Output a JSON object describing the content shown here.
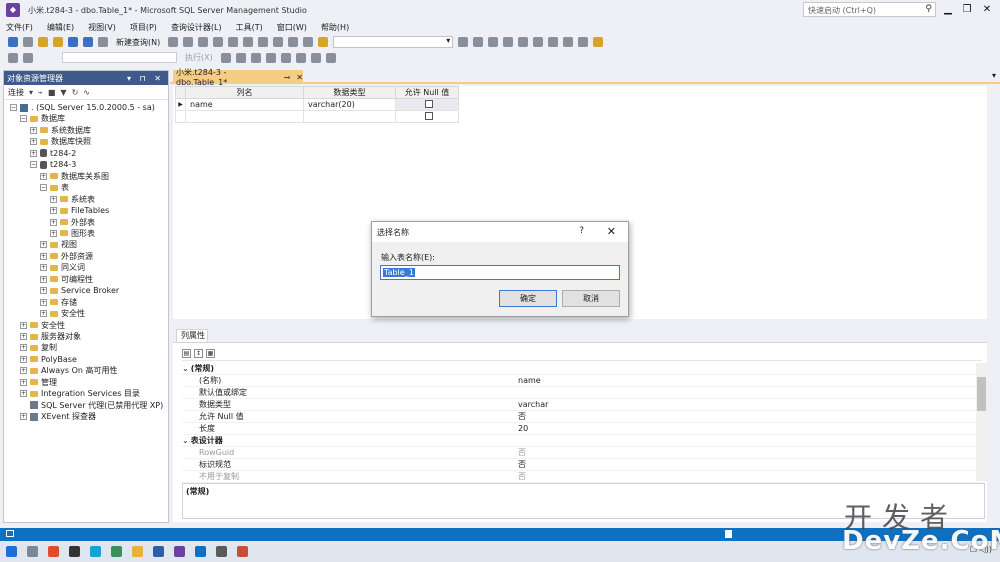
{
  "window": {
    "title": "小米.t284-3 - dbo.Table_1* - Microsoft SQL Server Management Studio",
    "quick_launch_placeholder": "快速启动 (Ctrl+Q)"
  },
  "menu": [
    "文件(F)",
    "编辑(E)",
    "视图(V)",
    "项目(P)",
    "查询设计器(L)",
    "工具(T)",
    "窗口(W)",
    "帮助(H)"
  ],
  "toolbar": {
    "new_query": "新建查询(N)",
    "execute": "执行(X)"
  },
  "object_explorer": {
    "title": "对象资源管理器",
    "connect_label": "连接",
    "nodes": [
      {
        "label": ". (SQL Server 15.0.2000.5 - sa)",
        "level": 0,
        "toggle": "−",
        "icon": "server-icon"
      },
      {
        "label": "数据库",
        "level": 1,
        "toggle": "−",
        "icon": "folder-icon"
      },
      {
        "label": "系统数据库",
        "level": 2,
        "toggle": "+",
        "icon": "folder-icon"
      },
      {
        "label": "数据库快照",
        "level": 2,
        "toggle": "+",
        "icon": "folder-icon"
      },
      {
        "label": "t284-2",
        "level": 2,
        "toggle": "+",
        "icon": "database-icon"
      },
      {
        "label": "t284-3",
        "level": 2,
        "toggle": "−",
        "icon": "database-icon"
      },
      {
        "label": "数据库关系图",
        "level": 3,
        "toggle": "+",
        "icon": "folder-icon"
      },
      {
        "label": "表",
        "level": 3,
        "toggle": "−",
        "icon": "folder-icon"
      },
      {
        "label": "系统表",
        "level": 4,
        "toggle": "+",
        "icon": "folder-icon"
      },
      {
        "label": "FileTables",
        "level": 4,
        "toggle": "+",
        "icon": "folder-icon"
      },
      {
        "label": "外部表",
        "level": 4,
        "toggle": "+",
        "icon": "folder-icon"
      },
      {
        "label": "图形表",
        "level": 4,
        "toggle": "+",
        "icon": "folder-icon"
      },
      {
        "label": "视图",
        "level": 3,
        "toggle": "+",
        "icon": "folder-icon"
      },
      {
        "label": "外部资源",
        "level": 3,
        "toggle": "+",
        "icon": "folder-icon"
      },
      {
        "label": "同义词",
        "level": 3,
        "toggle": "+",
        "icon": "folder-icon"
      },
      {
        "label": "可编程性",
        "level": 3,
        "toggle": "+",
        "icon": "folder-icon"
      },
      {
        "label": "Service Broker",
        "level": 3,
        "toggle": "+",
        "icon": "folder-icon"
      },
      {
        "label": "存储",
        "level": 3,
        "toggle": "+",
        "icon": "folder-icon"
      },
      {
        "label": "安全性",
        "level": 3,
        "toggle": "+",
        "icon": "folder-icon"
      },
      {
        "label": "安全性",
        "level": 1,
        "toggle": "+",
        "icon": "folder-icon"
      },
      {
        "label": "服务器对象",
        "level": 1,
        "toggle": "+",
        "icon": "folder-icon"
      },
      {
        "label": "复制",
        "level": 1,
        "toggle": "+",
        "icon": "folder-icon"
      },
      {
        "label": "PolyBase",
        "level": 1,
        "toggle": "+",
        "icon": "folder-icon"
      },
      {
        "label": "Always On 高可用性",
        "level": 1,
        "toggle": "+",
        "icon": "folder-icon"
      },
      {
        "label": "管理",
        "level": 1,
        "toggle": "+",
        "icon": "folder-icon"
      },
      {
        "label": "Integration Services 目录",
        "level": 1,
        "toggle": "+",
        "icon": "folder-icon"
      },
      {
        "label": "SQL Server 代理(已禁用代理 XP)",
        "level": 1,
        "toggle": "",
        "icon": "agent-icon"
      },
      {
        "label": "XEvent 探查器",
        "level": 1,
        "toggle": "+",
        "icon": "xevent-icon"
      }
    ]
  },
  "editor": {
    "tab_label": "小米.t284-3 - dbo.Table_1*",
    "columns_headers": [
      "列名",
      "数据类型",
      "允许 Null 值"
    ],
    "rows": [
      {
        "name": "name",
        "type": "varchar(20)",
        "allow_null": false
      },
      {
        "name": "",
        "type": "",
        "allow_null": false
      }
    ]
  },
  "dialog": {
    "title": "选择名称",
    "help": "?",
    "label": "输入表名称(E):",
    "value": "Table_1",
    "ok": "确定",
    "cancel": "取消"
  },
  "properties": {
    "tab": "列属性",
    "rows": [
      {
        "kind": "cat",
        "name": "(常规)"
      },
      {
        "kind": "prop",
        "name": "(名称)",
        "value": "name"
      },
      {
        "kind": "prop",
        "name": "默认值或绑定",
        "value": ""
      },
      {
        "kind": "prop",
        "name": "数据类型",
        "value": "varchar"
      },
      {
        "kind": "prop",
        "name": "允许 Null 值",
        "value": "否"
      },
      {
        "kind": "prop",
        "name": "长度",
        "value": "20"
      },
      {
        "kind": "cat",
        "name": "表设计器"
      },
      {
        "kind": "dis",
        "name": "RowGuid",
        "value": "否"
      },
      {
        "kind": "prop",
        "name": "标识规范",
        "value": "否"
      },
      {
        "kind": "dis",
        "name": "不用于复制",
        "value": "否"
      }
    ],
    "description": "(常规)"
  },
  "watermark": {
    "line1": "开发者",
    "line2": "DevZe.CoM"
  }
}
